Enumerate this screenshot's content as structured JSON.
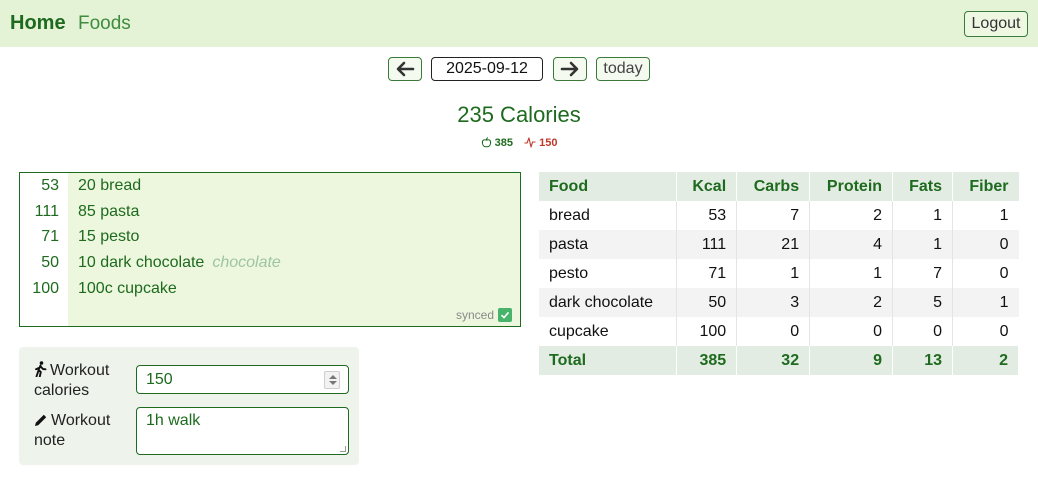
{
  "nav": {
    "home": "Home",
    "foods": "Foods",
    "logout": "Logout"
  },
  "date_nav": {
    "date": "2025-09-12",
    "today": "today"
  },
  "summary": {
    "title": "235 Calories",
    "eaten": "385",
    "burned": "150"
  },
  "entries": [
    {
      "kcal": "53",
      "text": "20 bread",
      "hint": ""
    },
    {
      "kcal": "111",
      "text": "85 pasta",
      "hint": ""
    },
    {
      "kcal": "71",
      "text": "15 pesto",
      "hint": ""
    },
    {
      "kcal": "50",
      "text": "10 dark chocolate",
      "hint": "chocolate"
    },
    {
      "kcal": "100",
      "text": "100c cupcake",
      "hint": ""
    }
  ],
  "sync_status": "synced",
  "workout": {
    "calories_label_1": "Workout",
    "calories_label_2": "calories",
    "calories_value": "150",
    "note_label_1": "Workout",
    "note_label_2": "note",
    "note_value": "1h walk"
  },
  "table": {
    "headers": [
      "Food",
      "Kcal",
      "Carbs",
      "Protein",
      "Fats",
      "Fiber"
    ],
    "rows": [
      [
        "bread",
        "53",
        "7",
        "2",
        "1",
        "1"
      ],
      [
        "pasta",
        "111",
        "21",
        "4",
        "1",
        "0"
      ],
      [
        "pesto",
        "71",
        "1",
        "1",
        "7",
        "0"
      ],
      [
        "dark chocolate",
        "50",
        "3",
        "2",
        "5",
        "1"
      ],
      [
        "cupcake",
        "100",
        "0",
        "0",
        "0",
        "0"
      ]
    ],
    "total": [
      "Total",
      "385",
      "32",
      "9",
      "13",
      "2"
    ]
  },
  "colors": {
    "brand_green": "#1e6a1e",
    "nav_bg": "#e4f3d6",
    "editor_bg": "#ecf7de",
    "burn_red": "#c0392b",
    "sync_check": "#48b36a"
  }
}
